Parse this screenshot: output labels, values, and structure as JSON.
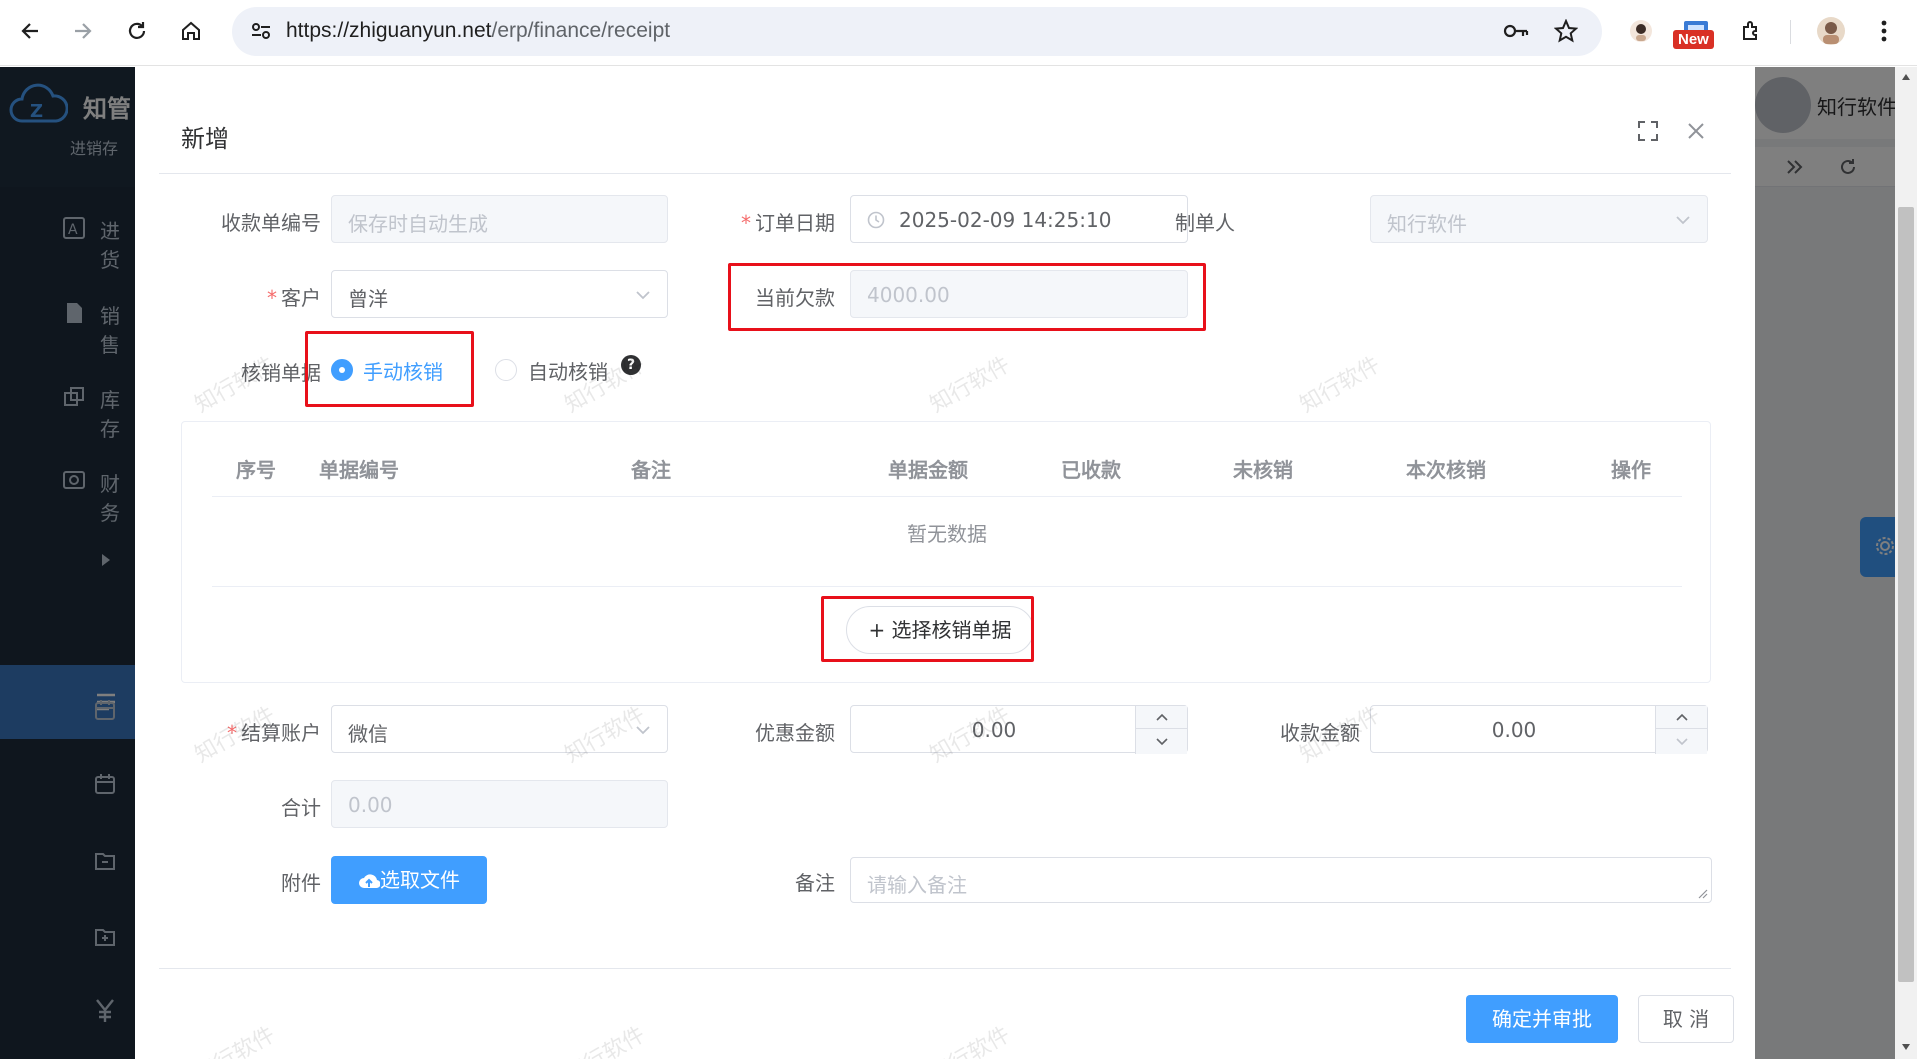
{
  "browser": {
    "url_host": "https://zhiguanyun.net",
    "url_path": "/erp/finance/receipt",
    "new_badge": "New"
  },
  "app": {
    "logo_text": "知管",
    "logo_sub": "进销存",
    "user_name": "知行软件",
    "sidebar_items": [
      {
        "label": "进货"
      },
      {
        "label": "销售"
      },
      {
        "label": "库存"
      },
      {
        "label": "财务"
      }
    ]
  },
  "dialog": {
    "title": "新增",
    "fields": {
      "receipt_no": {
        "label": "收款单编号",
        "placeholder": "保存时自动生成"
      },
      "order_date": {
        "label": "订单日期",
        "value": "2025-02-09 14:25:10"
      },
      "creator": {
        "label": "制单人",
        "value": "知行软件"
      },
      "customer": {
        "label": "客户",
        "value": "曾洋"
      },
      "current_debt": {
        "label": "当前欠款",
        "value": "4000.00"
      },
      "writeoff_doc": {
        "label": "核销单据",
        "options": [
          "手动核销",
          "自动核销"
        ],
        "selected": "手动核销"
      },
      "settle_account": {
        "label": "结算账户",
        "value": "微信"
      },
      "discount": {
        "label": "优惠金额",
        "value": "0.00"
      },
      "receipt_amount": {
        "label": "收款金额",
        "value": "0.00"
      },
      "total": {
        "label": "合计",
        "value": "0.00"
      },
      "attachment": {
        "label": "附件",
        "button": "选取文件"
      },
      "remark": {
        "label": "备注",
        "placeholder": "请输入备注"
      }
    },
    "table": {
      "columns": [
        "序号",
        "单据编号",
        "备注",
        "单据金额",
        "已收款",
        "未核销",
        "本次核销",
        "操作"
      ],
      "empty_text": "暂无数据",
      "select_button": "+ 选择核销单据"
    },
    "footer": {
      "confirm": "确定并审批",
      "cancel": "取 消"
    },
    "watermark": "知行软件"
  }
}
